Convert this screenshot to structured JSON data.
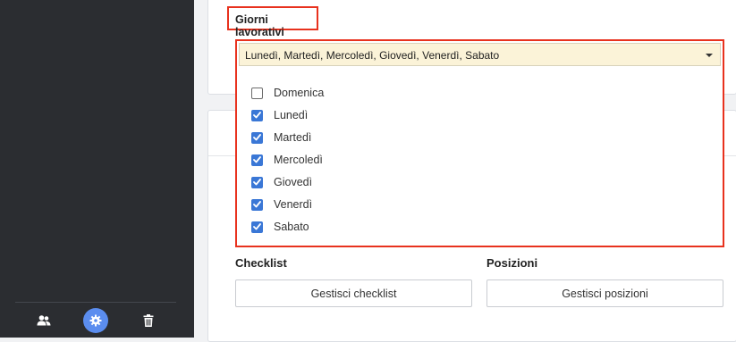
{
  "sidebar": {
    "icons": [
      "users-icon",
      "gear-icon",
      "trash-icon"
    ],
    "active_color": "#5b8def"
  },
  "working_days": {
    "label": "Giorni lavorativi",
    "selected_summary": "Lunedì, Martedì, Mercoledì, Giovedì, Venerdì, Sabato",
    "options": [
      {
        "label": "Domenica",
        "checked": false
      },
      {
        "label": "Lunedì",
        "checked": true
      },
      {
        "label": "Martedì",
        "checked": true
      },
      {
        "label": "Mercoledì",
        "checked": true
      },
      {
        "label": "Giovedì",
        "checked": true
      },
      {
        "label": "Venerdì",
        "checked": true
      },
      {
        "label": "Sabato",
        "checked": true
      }
    ]
  },
  "checklist": {
    "label": "Checklist",
    "button_label": "Gestisci checklist"
  },
  "positions": {
    "label": "Posizioni",
    "button_label": "Gestisci posizioni"
  },
  "colors": {
    "highlight_border": "#e8321e",
    "select_background": "#fbf3d8",
    "checkbox_checked": "#3a77d6"
  }
}
